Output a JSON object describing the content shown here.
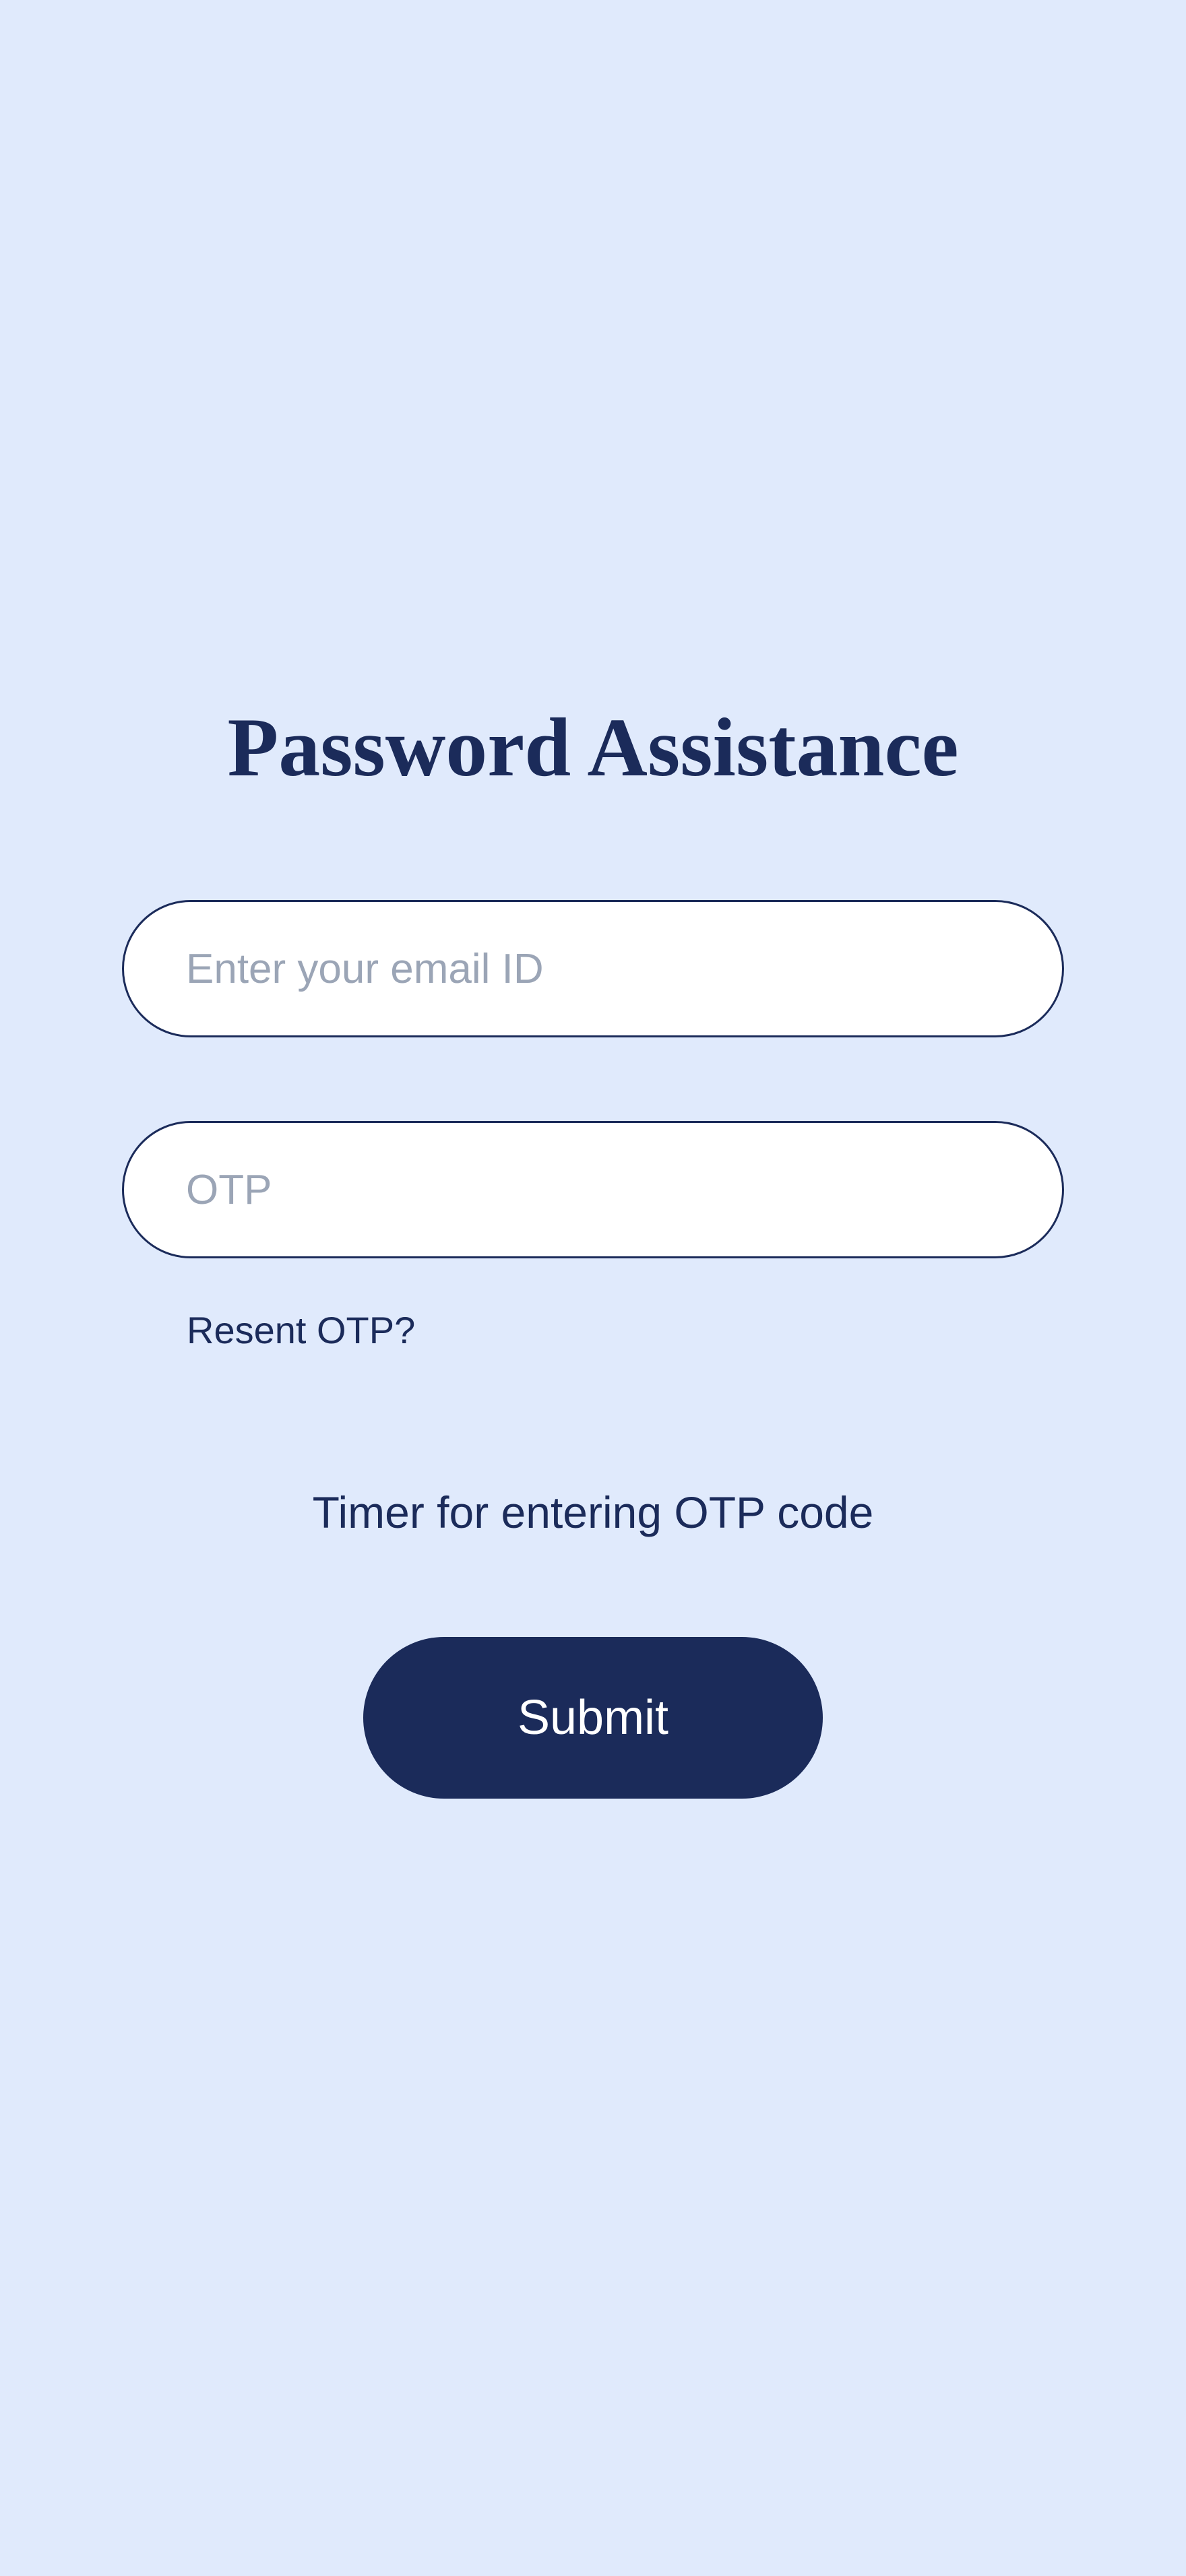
{
  "page": {
    "title": "Password Assistance"
  },
  "form": {
    "email": {
      "placeholder": "Enter your email ID",
      "value": ""
    },
    "otp": {
      "placeholder": "OTP",
      "value": ""
    },
    "resend_label": "Resent OTP?",
    "timer_label": "Timer for entering OTP code",
    "submit_label": "Submit"
  },
  "colors": {
    "background": "#e0eafc",
    "primary": "#1b2b5a",
    "field_background": "#ffffff",
    "placeholder": "#9ba5b6"
  }
}
